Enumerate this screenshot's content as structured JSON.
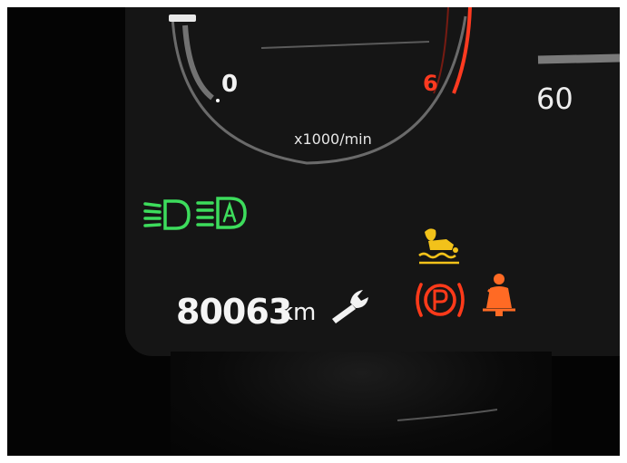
{
  "tachometer": {
    "tick_labels": [
      "0",
      "6"
    ],
    "unit": "x1000/min"
  },
  "speedometer": {
    "tick_label": "60"
  },
  "odometer": {
    "value": "80063",
    "unit": "km"
  },
  "icons": [
    "low-beam-headlight-icon",
    "auto-headlight-icon",
    "engine-oil-level-icon",
    "parking-brake-icon",
    "seatbelt-warning-icon",
    "service-wrench-icon"
  ],
  "colors": {
    "indicator_green": "#3ddc5c",
    "indicator_amber": "#f2c21a",
    "indicator_red": "#ff3a1a",
    "redline": "#ff3a20"
  }
}
